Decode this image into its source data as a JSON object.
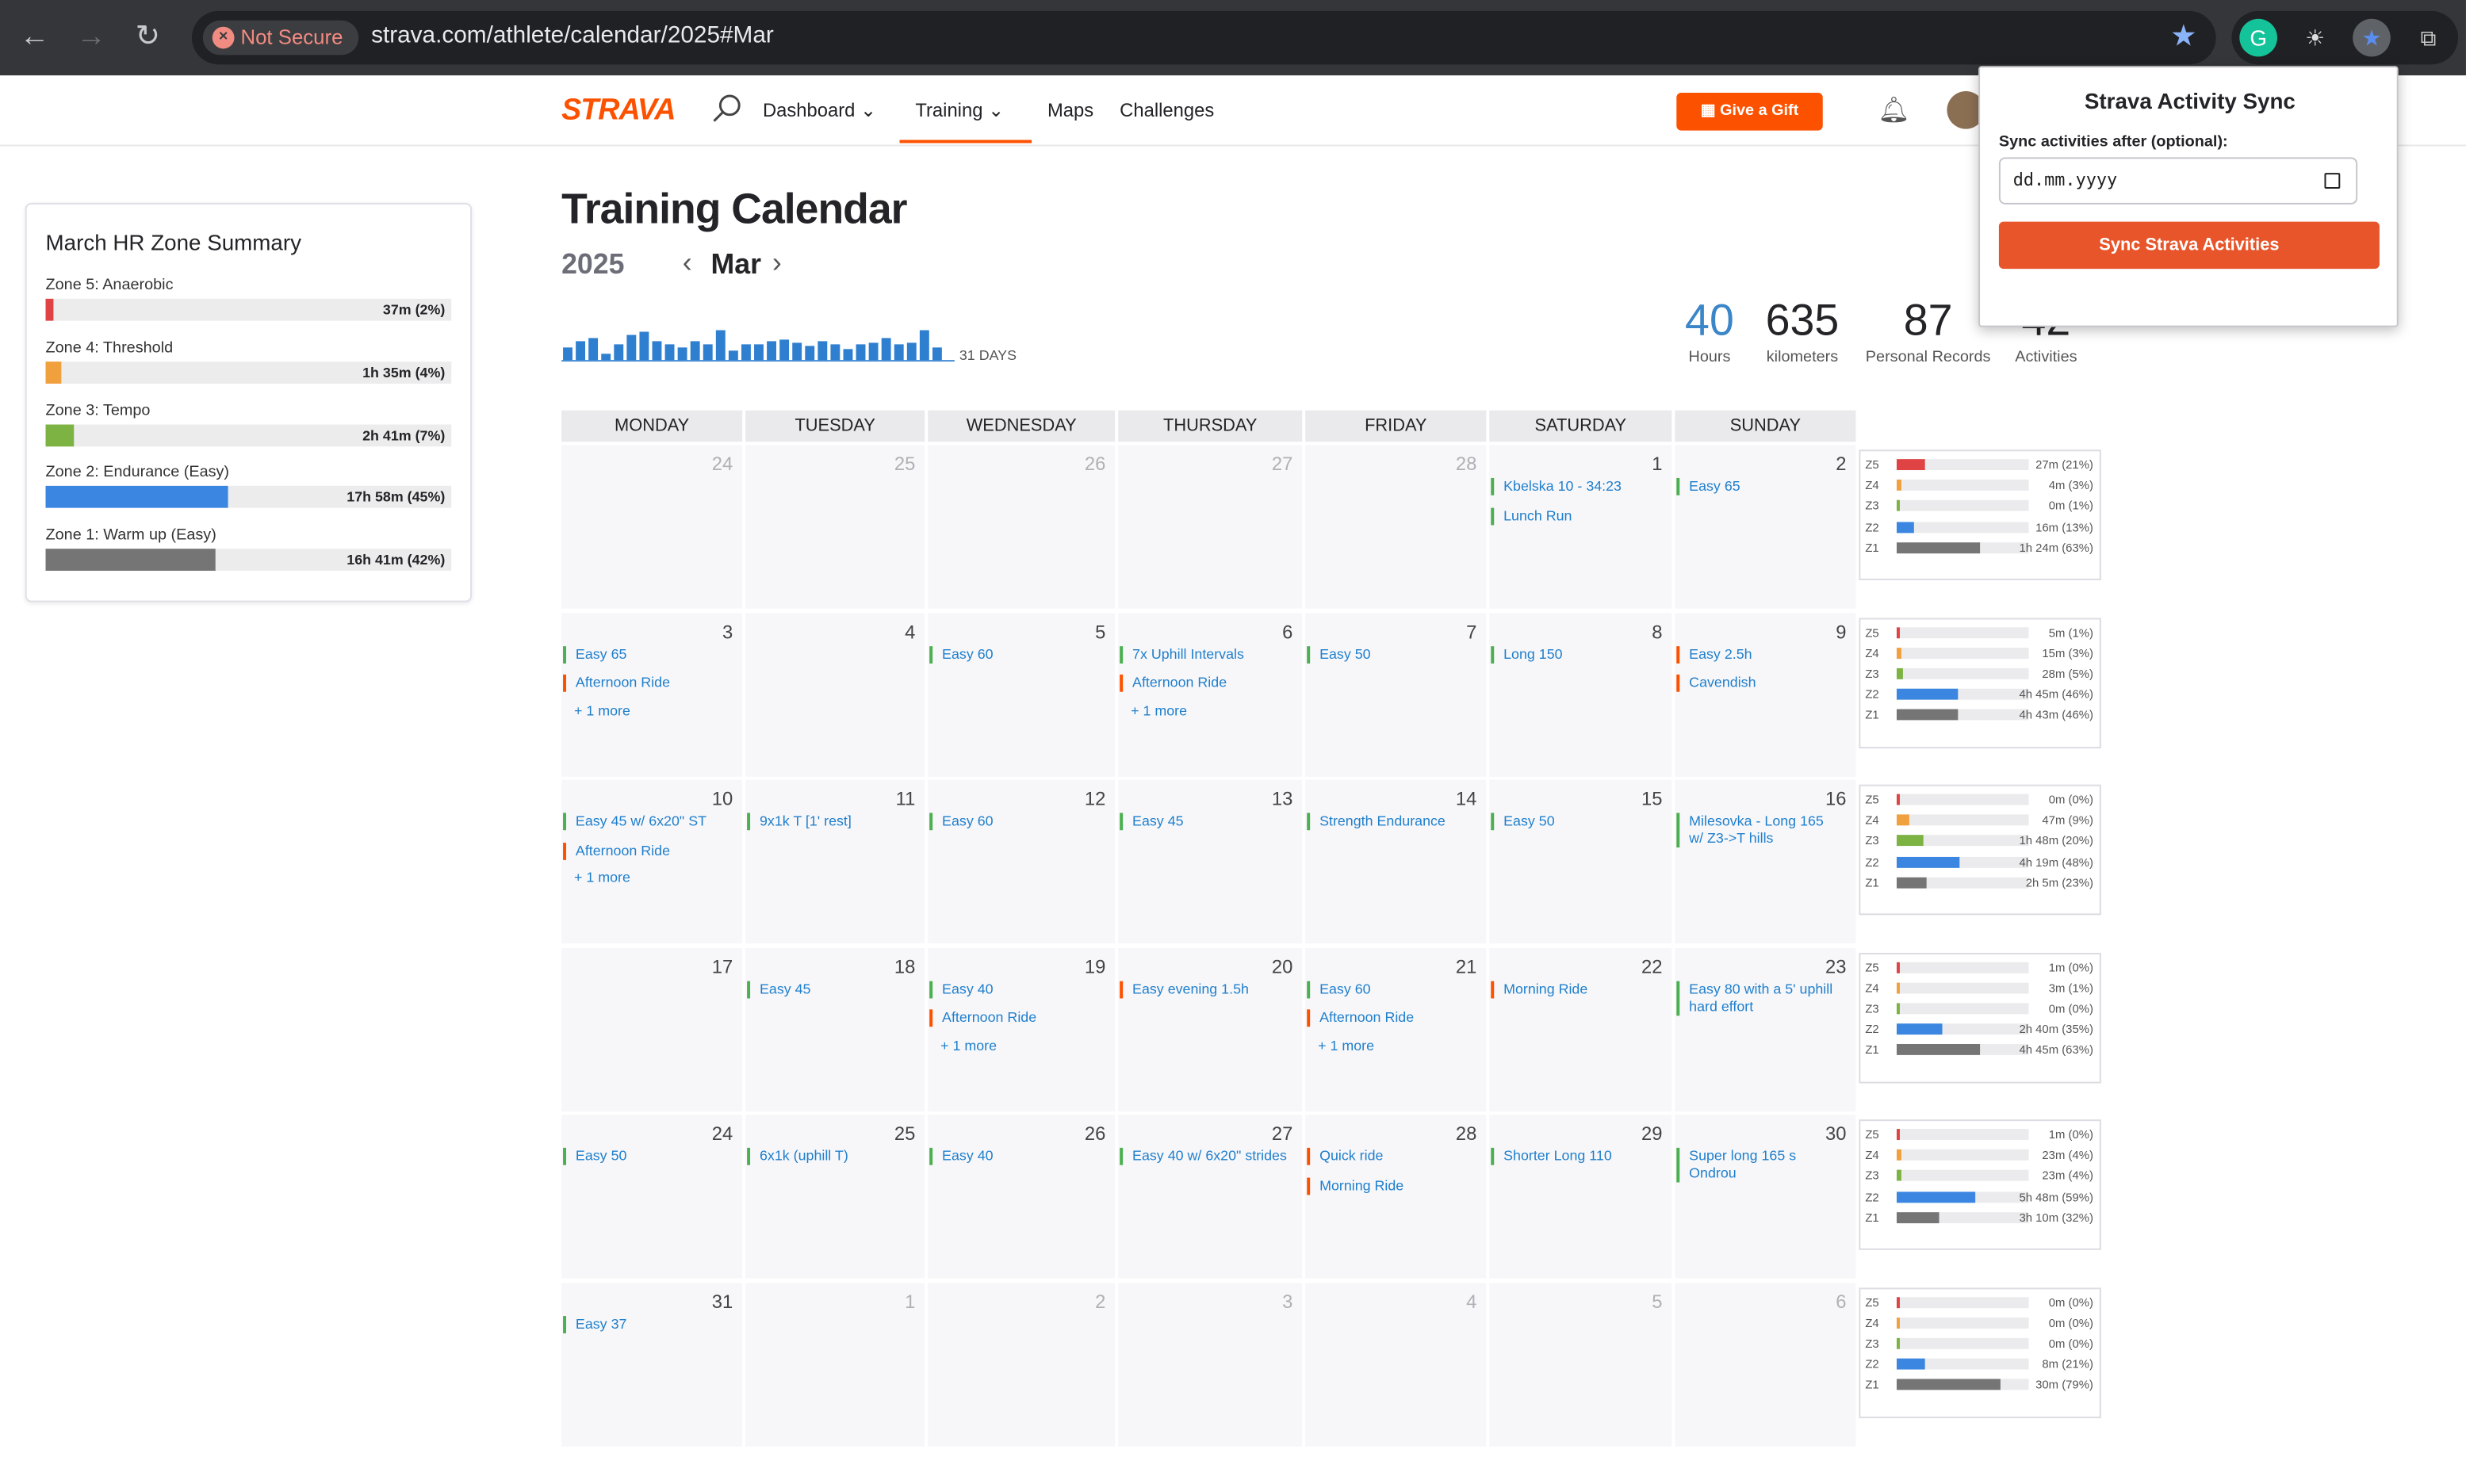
{
  "browser": {
    "url": "strava.com/athlete/calendar/2025#Mar",
    "security": "Not Secure"
  },
  "nav": {
    "logo": "STRAVA",
    "dashboard": "Dashboard",
    "training": "Training",
    "maps": "Maps",
    "challenges": "Challenges",
    "gift": "Give a Gift"
  },
  "zone_summary": {
    "title": "March HR Zone Summary",
    "zones": [
      {
        "label": "Zone 5: Anaerobic",
        "value": "37m (2%)",
        "fraction": 0.02,
        "color": "#e04343"
      },
      {
        "label": "Zone 4: Threshold",
        "value": "1h 35m (4%)",
        "fraction": 0.04,
        "color": "#f0a03c"
      },
      {
        "label": "Zone 3: Tempo",
        "value": "2h 41m (7%)",
        "fraction": 0.07,
        "color": "#7cb342"
      },
      {
        "label": "Zone 2: Endurance (Easy)",
        "value": "17h 58m (45%)",
        "fraction": 0.45,
        "color": "#3a86e0"
      },
      {
        "label": "Zone 1: Warm up (Easy)",
        "value": "16h 41m (42%)",
        "fraction": 0.42,
        "color": "#757575"
      }
    ]
  },
  "title": "Training Calendar",
  "year": "2025",
  "month": "Mar",
  "days_label": "31 DAYS",
  "stats": [
    {
      "value": "40",
      "label": "Hours",
      "color": "#3a86c8"
    },
    {
      "value": "635",
      "label": "kilometers",
      "color": "#242428"
    },
    {
      "value": "87",
      "label": "Personal Records",
      "color": "#242428"
    },
    {
      "value": "42",
      "label": "Activities",
      "color": "#242428"
    }
  ],
  "weekdays": [
    "MONDAY",
    "TUESDAY",
    "WEDNESDAY",
    "THURSDAY",
    "FRIDAY",
    "SATURDAY",
    "SUNDAY"
  ],
  "weeks": [
    {
      "days": [
        {
          "n": "24",
          "grey": true,
          "ev": []
        },
        {
          "n": "25",
          "grey": true,
          "ev": []
        },
        {
          "n": "26",
          "grey": true,
          "ev": []
        },
        {
          "n": "27",
          "grey": true,
          "ev": []
        },
        {
          "n": "28",
          "grey": true,
          "ev": []
        },
        {
          "n": "1",
          "ev": [
            {
              "t": "Kbelska 10 - 34:23"
            },
            {
              "t": "Lunch Run"
            }
          ]
        },
        {
          "n": "2",
          "ev": [
            {
              "t": "Easy 65"
            }
          ]
        }
      ],
      "zones": [
        [
          "Z5",
          "27m (21%)",
          0.21,
          "#e04343"
        ],
        [
          "Z4",
          "4m (3%)",
          0.03,
          "#f0a03c"
        ],
        [
          "Z3",
          "0m (1%)",
          0.01,
          "#7cb342"
        ],
        [
          "Z2",
          "16m (13%)",
          0.13,
          "#3a86e0"
        ],
        [
          "Z1",
          "1h 24m (63%)",
          0.63,
          "#757575"
        ]
      ]
    },
    {
      "days": [
        {
          "n": "3",
          "ev": [
            {
              "t": "Easy 65"
            },
            {
              "t": "Afternoon Ride",
              "ride": true
            }
          ],
          "more": "+ 1 more"
        },
        {
          "n": "4",
          "ev": []
        },
        {
          "n": "5",
          "ev": [
            {
              "t": "Easy 60"
            }
          ]
        },
        {
          "n": "6",
          "ev": [
            {
              "t": "7x Uphill Intervals"
            },
            {
              "t": "Afternoon Ride",
              "ride": true
            }
          ],
          "more": "+ 1 more"
        },
        {
          "n": "7",
          "ev": [
            {
              "t": "Easy 50"
            }
          ]
        },
        {
          "n": "8",
          "ev": [
            {
              "t": "Long 150"
            }
          ]
        },
        {
          "n": "9",
          "ev": [
            {
              "t": "Easy 2.5h",
              "ride": true
            },
            {
              "t": "Cavendish",
              "ride": true
            }
          ]
        }
      ],
      "zones": [
        [
          "Z5",
          "5m (1%)",
          0.01,
          "#e04343"
        ],
        [
          "Z4",
          "15m (3%)",
          0.03,
          "#f0a03c"
        ],
        [
          "Z3",
          "28m (5%)",
          0.05,
          "#7cb342"
        ],
        [
          "Z2",
          "4h 45m (46%)",
          0.46,
          "#3a86e0"
        ],
        [
          "Z1",
          "4h 43m (46%)",
          0.46,
          "#757575"
        ]
      ]
    },
    {
      "days": [
        {
          "n": "10",
          "ev": [
            {
              "t": "Easy 45 w/ 6x20\" ST"
            },
            {
              "t": "Afternoon Ride",
              "ride": true
            }
          ],
          "more": "+ 1 more"
        },
        {
          "n": "11",
          "ev": [
            {
              "t": "9x1k T [1' rest]"
            }
          ]
        },
        {
          "n": "12",
          "ev": [
            {
              "t": "Easy 60"
            }
          ]
        },
        {
          "n": "13",
          "ev": [
            {
              "t": "Easy 45"
            }
          ]
        },
        {
          "n": "14",
          "ev": [
            {
              "t": "Strength Endurance"
            }
          ]
        },
        {
          "n": "15",
          "ev": [
            {
              "t": "Easy 50"
            }
          ]
        },
        {
          "n": "16",
          "ev": [
            {
              "t": "Milesovka - Long 165 w/ Z3->T hills",
              "two": true
            }
          ]
        }
      ],
      "zones": [
        [
          "Z5",
          "0m (0%)",
          0,
          "#e04343"
        ],
        [
          "Z4",
          "47m (9%)",
          0.09,
          "#f0a03c"
        ],
        [
          "Z3",
          "1h 48m (20%)",
          0.2,
          "#7cb342"
        ],
        [
          "Z2",
          "4h 19m (48%)",
          0.48,
          "#3a86e0"
        ],
        [
          "Z1",
          "2h 5m (23%)",
          0.23,
          "#757575"
        ]
      ]
    },
    {
      "days": [
        {
          "n": "17",
          "ev": []
        },
        {
          "n": "18",
          "ev": [
            {
              "t": "Easy 45"
            }
          ]
        },
        {
          "n": "19",
          "ev": [
            {
              "t": "Easy 40"
            },
            {
              "t": "Afternoon Ride",
              "ride": true
            }
          ],
          "more": "+ 1 more"
        },
        {
          "n": "20",
          "ev": [
            {
              "t": "Easy evening 1.5h",
              "ride": true
            }
          ]
        },
        {
          "n": "21",
          "ev": [
            {
              "t": "Easy 60"
            },
            {
              "t": "Afternoon Ride",
              "ride": true
            }
          ],
          "more": "+ 1 more"
        },
        {
          "n": "22",
          "ev": [
            {
              "t": "Morning Ride",
              "ride": true
            }
          ]
        },
        {
          "n": "23",
          "ev": [
            {
              "t": "Easy 80 with a 5' uphill hard effort",
              "two": true
            }
          ]
        }
      ],
      "zones": [
        [
          "Z5",
          "1m (0%)",
          0,
          "#e04343"
        ],
        [
          "Z4",
          "3m (1%)",
          0.01,
          "#f0a03c"
        ],
        [
          "Z3",
          "0m (0%)",
          0,
          "#7cb342"
        ],
        [
          "Z2",
          "2h 40m (35%)",
          0.35,
          "#3a86e0"
        ],
        [
          "Z1",
          "4h 45m (63%)",
          0.63,
          "#757575"
        ]
      ]
    },
    {
      "days": [
        {
          "n": "24",
          "ev": [
            {
              "t": "Easy 50"
            }
          ]
        },
        {
          "n": "25",
          "ev": [
            {
              "t": "6x1k (uphill T)"
            }
          ]
        },
        {
          "n": "26",
          "ev": [
            {
              "t": "Easy 40"
            }
          ]
        },
        {
          "n": "27",
          "ev": [
            {
              "t": "Easy 40 w/ 6x20\" strides"
            }
          ]
        },
        {
          "n": "28",
          "ev": [
            {
              "t": "Quick ride",
              "ride": true
            },
            {
              "t": "Morning Ride",
              "ride": true
            }
          ]
        },
        {
          "n": "29",
          "ev": [
            {
              "t": "Shorter Long 110"
            }
          ]
        },
        {
          "n": "30",
          "ev": [
            {
              "t": "Super long 165 s Ondrou"
            }
          ]
        }
      ],
      "zones": [
        [
          "Z5",
          "1m (0%)",
          0,
          "#e04343"
        ],
        [
          "Z4",
          "23m (4%)",
          0.04,
          "#f0a03c"
        ],
        [
          "Z3",
          "23m (4%)",
          0.04,
          "#7cb342"
        ],
        [
          "Z2",
          "5h 48m (59%)",
          0.59,
          "#3a86e0"
        ],
        [
          "Z1",
          "3h 10m (32%)",
          0.32,
          "#757575"
        ]
      ]
    },
    {
      "days": [
        {
          "n": "31",
          "ev": [
            {
              "t": "Easy 37"
            }
          ]
        },
        {
          "n": "1",
          "grey": true,
          "ev": []
        },
        {
          "n": "2",
          "grey": true,
          "ev": []
        },
        {
          "n": "3",
          "grey": true,
          "ev": []
        },
        {
          "n": "4",
          "grey": true,
          "ev": []
        },
        {
          "n": "5",
          "grey": true,
          "ev": []
        },
        {
          "n": "6",
          "grey": true,
          "ev": []
        }
      ],
      "zones": [
        [
          "Z5",
          "0m (0%)",
          0,
          "#e04343"
        ],
        [
          "Z4",
          "0m (0%)",
          0,
          "#f0a03c"
        ],
        [
          "Z3",
          "0m (0%)",
          0,
          "#7cb342"
        ],
        [
          "Z2",
          "8m (21%)",
          0.21,
          "#3a86e0"
        ],
        [
          "Z1",
          "30m (79%)",
          0.79,
          "#757575"
        ]
      ]
    }
  ],
  "spark": [
    0.4,
    0.6,
    0.7,
    0.2,
    0.5,
    0.8,
    0.9,
    0.6,
    0.5,
    0.4,
    0.6,
    0.5,
    0.95,
    0.3,
    0.5,
    0.5,
    0.6,
    0.65,
    0.55,
    0.45,
    0.6,
    0.5,
    0.35,
    0.5,
    0.55,
    0.7,
    0.5,
    0.55,
    0.95,
    0.4
  ],
  "popup": {
    "title": "Strava Activity Sync",
    "label": "Sync activities after (optional):",
    "placeholder": "dd.mm.yyyy",
    "button": "Sync Strava Activities"
  }
}
